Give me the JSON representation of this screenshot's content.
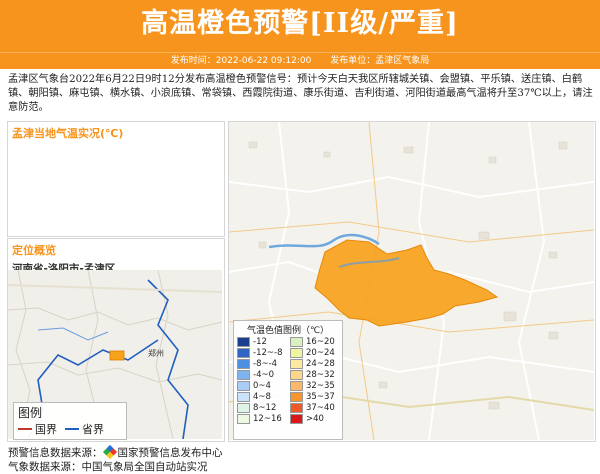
{
  "header": {
    "title": "高温橙色预警[II级/严重]"
  },
  "subbar": {
    "publish_time": "发布时间：2022-06-22 09:12:00",
    "publisher": "发布单位：孟津区气象局"
  },
  "description": "孟津区气象台2022年6月22日9时12分发布高温橙色预警信号：预计今天白天我区所辖城关镇、会盟镇、平乐镇、送庄镇、白鹤镇、朝阳镇、麻屯镇、横水镇、小浪底镇、常袋镇、西霞院街道、康乐街道、吉利街道、河阳街道最高气温将升至37℃以上，请注意防范。",
  "live_panel": {
    "title": "孟津当地气温实况(℃)"
  },
  "location_panel": {
    "title": "定位概览",
    "location": "河南省-洛阳市-孟津区"
  },
  "small_map": {
    "city_label": "郑州",
    "legend_title": "图例",
    "legend_items": [
      {
        "label": "国界",
        "color": "#c0392b"
      },
      {
        "label": "省界",
        "color": "#1f5fbf"
      }
    ]
  },
  "temp_legend": {
    "title": "气温色值图例（℃）",
    "items": [
      {
        "label": "-12",
        "color": "#1b3f8f"
      },
      {
        "label": "16~20",
        "color": "#d9f0c0"
      },
      {
        "label": "-12~-8",
        "color": "#2f66c4"
      },
      {
        "label": "20~24",
        "color": "#eef5a0"
      },
      {
        "label": "-8~-4",
        "color": "#4f8fe0"
      },
      {
        "label": "24~28",
        "color": "#fbeaa0"
      },
      {
        "label": "-4~0",
        "color": "#7fb3ef"
      },
      {
        "label": "28~32",
        "color": "#fcd78a"
      },
      {
        "label": "0~4",
        "color": "#a9cdf5"
      },
      {
        "label": "32~35",
        "color": "#fbb86a"
      },
      {
        "label": "4~8",
        "color": "#c9e4fa"
      },
      {
        "label": "35~37",
        "color": "#f7942d"
      },
      {
        "label": "8~12",
        "color": "#dff3e8"
      },
      {
        "label": "37~40",
        "color": "#f05a28"
      },
      {
        "label": "12~16",
        "color": "#eef9e4"
      },
      {
        "label": ">40",
        "color": "#d7191c"
      }
    ]
  },
  "footer": {
    "source_label": "预警信息数据来源：",
    "source_name": "国家预警信息发布中心",
    "data_source": "气象数据来源：中国气象局全国自动站实况"
  },
  "colors": {
    "accent": "#f7941d",
    "warning_area": "#f7a21b"
  }
}
